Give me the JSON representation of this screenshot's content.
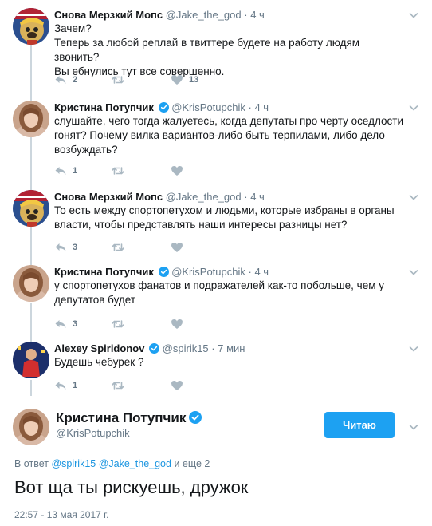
{
  "thread": [
    {
      "name": "Снова Мерзкий Мопс",
      "handle": "@Jake_the_god",
      "sep": "·",
      "time": "4 ч",
      "verified": false,
      "avatar": "pug-trump-avatar",
      "lines": [
        "Зачем?",
        "Теперь за любой реплай в твиттере будете на работу людям звонить?",
        "Вы ебнулись тут все совершенно."
      ],
      "replies": "2",
      "retweets": "",
      "likes": "13"
    },
    {
      "name": "Кристина Потупчик",
      "handle": "@KrisPotupchik",
      "sep": "·",
      "time": "4 ч",
      "verified": true,
      "avatar": "woman-avatar",
      "lines": [
        "слушайте, чего тогда жалуетесь, когда депутаты про черту оседлости",
        "гонят? Почему вилка вариантов-либо быть терпилами, либо дело",
        "возбуждать?"
      ],
      "replies": "1",
      "retweets": "",
      "likes": ""
    },
    {
      "name": "Снова Мерзкий Мопс",
      "handle": "@Jake_the_god",
      "sep": "·",
      "time": "4 ч",
      "verified": false,
      "avatar": "pug-trump-avatar",
      "lines": [
        "То есть между спортопетухом и людьми, которые избраны в органы",
        "власти, чтобы представлять наши интересы разницы нет?"
      ],
      "replies": "3",
      "retweets": "",
      "likes": ""
    },
    {
      "name": "Кристина Потупчик",
      "handle": "@KrisPotupchik",
      "sep": "·",
      "time": "4 ч",
      "verified": true,
      "avatar": "woman-avatar",
      "lines": [
        "у спортопетухов фанатов и подражателей как-то побольше, чем у",
        "депутатов будет"
      ],
      "replies": "3",
      "retweets": "",
      "likes": ""
    },
    {
      "name": "Alexey Spiridonov",
      "handle": "@spirik15",
      "sep": "·",
      "time": "7 мин",
      "verified": true,
      "avatar": "athlete-avatar",
      "lines": [
        "Будешь чебурек ?"
      ],
      "replies": "1",
      "retweets": "",
      "likes": ""
    }
  ],
  "main": {
    "name": "Кристина Потупчик",
    "handle": "@KrisPotupchik",
    "follow_label": "Читаю",
    "reply_prefix": "В ответ",
    "reply_mention_1": "@spirik15",
    "reply_mention_2": "@Jake_the_god",
    "reply_suffix": "и еще 2",
    "text": "Вот ща ты рискуешь, дружок",
    "date": "22:57 - 13 мая 2017 г."
  },
  "colors": {
    "accent": "#1da1f2",
    "link": "#1b95e0",
    "muted": "#657786",
    "line": "#ccd6dd",
    "icon": "#aab8c2"
  }
}
